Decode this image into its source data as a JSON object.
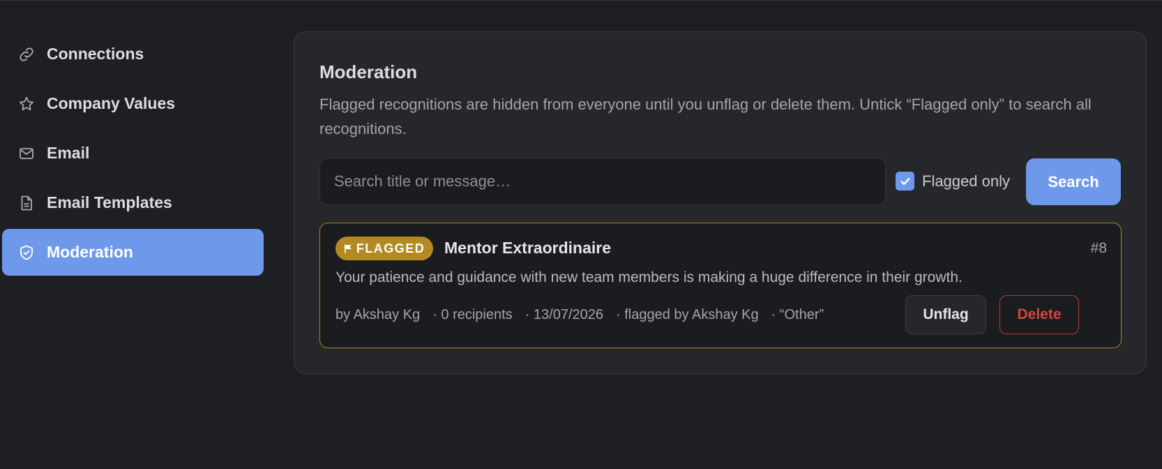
{
  "sidebar": {
    "items": [
      {
        "label": "Connections",
        "icon": "link-icon",
        "active": false
      },
      {
        "label": "Company Values",
        "icon": "star-icon",
        "active": false
      },
      {
        "label": "Email",
        "icon": "mail-icon",
        "active": false
      },
      {
        "label": "Email Templates",
        "icon": "document-icon",
        "active": false
      },
      {
        "label": "Moderation",
        "icon": "shield-check-icon",
        "active": true
      }
    ]
  },
  "moderation": {
    "title": "Moderation",
    "description": "Flagged recognitions are hidden from everyone until you unflag or delete them. Untick “Flagged only” to search all recognitions.",
    "search": {
      "placeholder": "Search title or message…",
      "value": "",
      "flagged_only_label": "Flagged only",
      "flagged_only_checked": true,
      "button_label": "Search"
    },
    "results": [
      {
        "badge": "FLAGGED",
        "badge_icon": "flag-icon",
        "title": "Mentor Extraordinaire",
        "id": "#8",
        "message": "Your patience and guidance with new team members is making a huge difference in their growth.",
        "meta": {
          "author": "by Akshay Kg",
          "recipients": "· 0 recipients",
          "date": "· 13/07/2026",
          "flagged_by": "· flagged by Akshay Kg",
          "reason": "· “Other”"
        },
        "unflag_label": "Unflag",
        "delete_label": "Delete"
      }
    ]
  },
  "colors": {
    "background": "#1e1f22",
    "panel": "#26272b",
    "accent": "#6e99ea",
    "flag": "#b38a22",
    "danger": "#d2473d"
  }
}
